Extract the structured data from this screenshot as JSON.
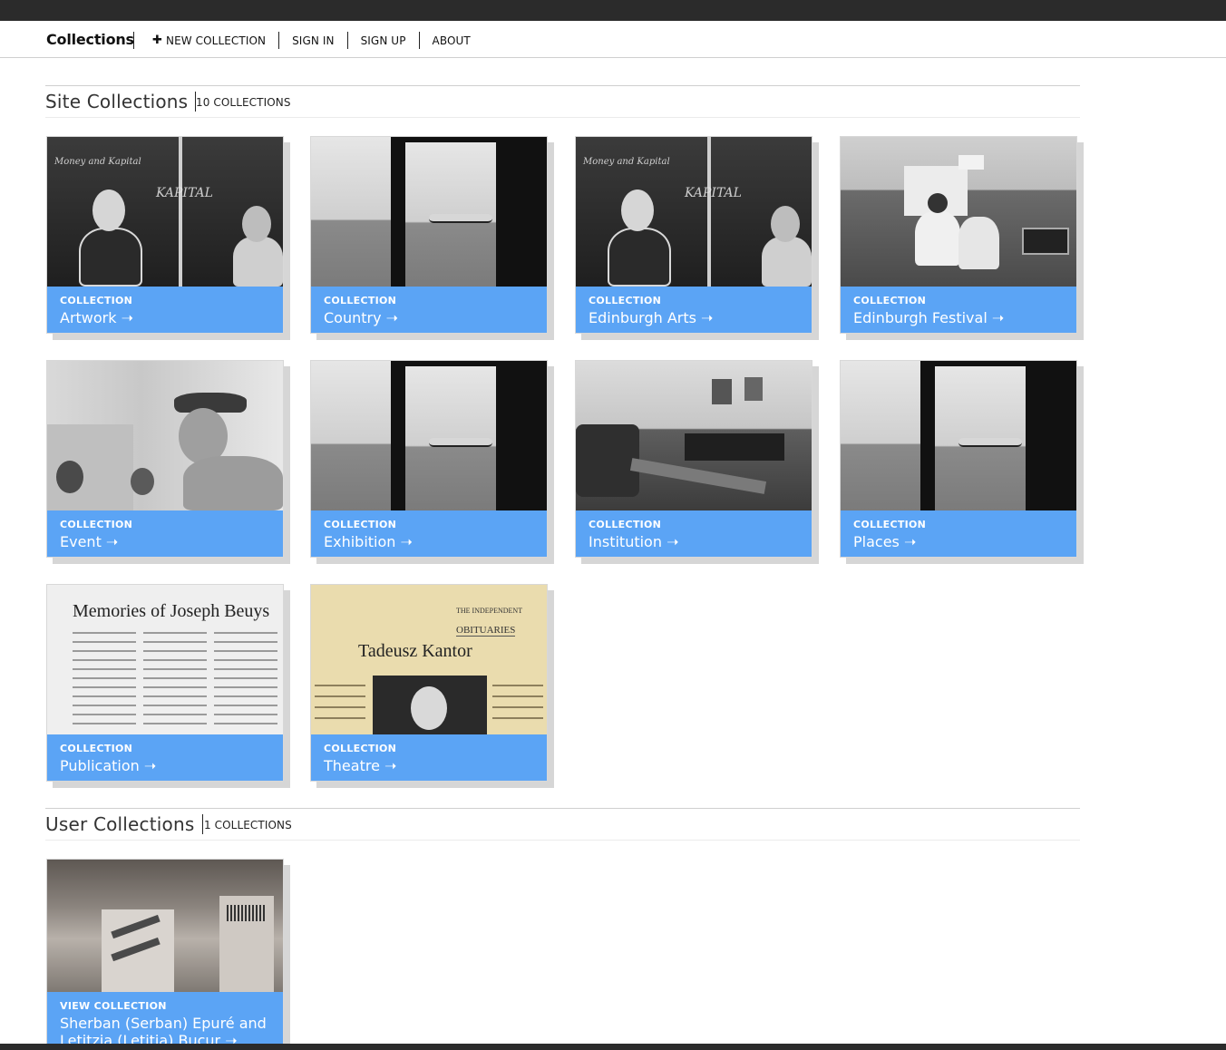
{
  "nav": {
    "brand": "Collections",
    "links": [
      {
        "label": "NEW COLLECTION",
        "icon": "plus-icon"
      },
      {
        "label": "SIGN IN"
      },
      {
        "label": "SIGN UP"
      },
      {
        "label": "ABOUT"
      }
    ]
  },
  "site_collections": {
    "title": "Site Collections",
    "count": "10 COLLECTIONS",
    "cards": [
      {
        "kicker": "COLLECTION",
        "title": "Artwork ➝"
      },
      {
        "kicker": "COLLECTION",
        "title": "Country ➝"
      },
      {
        "kicker": "COLLECTION",
        "title": "Edinburgh Arts ➝"
      },
      {
        "kicker": "COLLECTION",
        "title": "Edinburgh Festival ➝"
      },
      {
        "kicker": "COLLECTION",
        "title": "Event ➝"
      },
      {
        "kicker": "COLLECTION",
        "title": "Exhibition ➝"
      },
      {
        "kicker": "COLLECTION",
        "title": "Institution ➝"
      },
      {
        "kicker": "COLLECTION",
        "title": "Places ➝"
      },
      {
        "kicker": "COLLECTION",
        "title": "Publication ➝"
      },
      {
        "kicker": "COLLECTION",
        "title": "Theatre ➝"
      }
    ]
  },
  "user_collections": {
    "title": "User Collections",
    "count": "1 COLLECTIONS",
    "cards": [
      {
        "kicker": "VIEW COLLECTION",
        "title": "Sherban (Serban) Epuré and Letitzia (Letitia) Bucur ➝"
      }
    ]
  },
  "thumb_text": {
    "blackboard_1": "Money and Kapital",
    "blackboard_2": "KAPITAL",
    "publication_headline": "Memories of Joseph Beuys",
    "theatre_masthead": "THE INDEPENDENT",
    "theatre_section": "OBITUARIES",
    "theatre_headline": "Tadeusz Kantor"
  },
  "colors": {
    "accent": "#5ba4f5",
    "topbar": "#2b2b2b"
  }
}
